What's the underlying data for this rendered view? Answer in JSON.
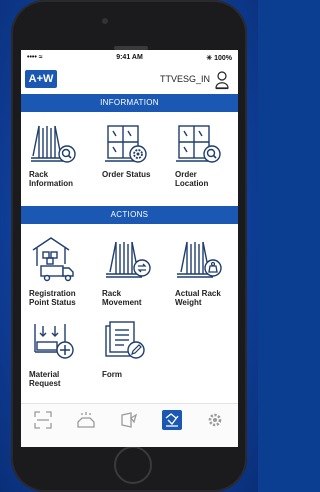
{
  "status_bar": {
    "signal": "•••• ≈",
    "time": "9:41 AM",
    "battery": "✳ 100%"
  },
  "header": {
    "logo_text": "A+W",
    "username": "TTVESG_IN"
  },
  "sections": {
    "information_title": "INFORMATION",
    "actions_title": "ACTIONS"
  },
  "information_items": [
    {
      "label_line1": "Rack",
      "label_line2": "Information",
      "icon": "rack-search-icon"
    },
    {
      "label_line1": "Order Status",
      "label_line2": "",
      "icon": "window-gear-icon"
    },
    {
      "label_line1": "Order",
      "label_line2": "Location",
      "icon": "window-search-icon"
    }
  ],
  "action_items": [
    {
      "label_line1": "Registration",
      "label_line2": "Point Status",
      "icon": "truck-warehouse-icon"
    },
    {
      "label_line1": "Rack",
      "label_line2": "Movement",
      "icon": "rack-exchange-icon"
    },
    {
      "label_line1": "Actual Rack",
      "label_line2": "Weight",
      "icon": "rack-weight-icon"
    },
    {
      "label_line1": "Material",
      "label_line2": "Request",
      "icon": "material-add-icon"
    },
    {
      "label_line1": "Form",
      "label_line2": "",
      "icon": "form-edit-icon"
    }
  ],
  "tabbar": [
    {
      "icon": "scan-icon",
      "active": false
    },
    {
      "icon": "tray-icon",
      "active": false
    },
    {
      "icon": "rack-tag-icon",
      "active": false
    },
    {
      "icon": "home-check-icon",
      "active": true
    },
    {
      "icon": "gear-icon",
      "active": false
    }
  ],
  "colors": {
    "brand": "#1a58b4",
    "icon_stroke": "#1f3d6e",
    "background": "#0b3d91"
  }
}
